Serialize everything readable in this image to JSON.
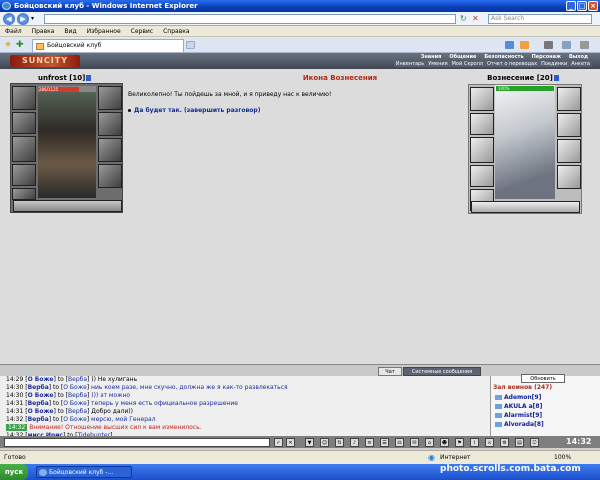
{
  "window": {
    "title": "Бойцовский клуб - Windows Internet Explorer"
  },
  "address": {
    "url": "",
    "search_placeholder": "Ask Search"
  },
  "menu": [
    "Файл",
    "Правка",
    "Вид",
    "Избранное",
    "Сервис",
    "Справка"
  ],
  "tab": {
    "label": "Бойцовский клуб"
  },
  "site": {
    "logo": "SUNCITY",
    "nav_top": [
      "Знания",
      "Общение",
      "Безопасность",
      "Персонаж",
      "Выход"
    ],
    "nav_sub": [
      "Инвентарь",
      "Умения",
      "Мой Скролл",
      "Отчет о переводах",
      "Поединки",
      "Анкета"
    ]
  },
  "left_char": {
    "name": "unfrost",
    "level": "[10]",
    "hp": "286/1125"
  },
  "dialog": {
    "title": "Икона Вознесения",
    "text": "Великолепно! Ты пойдешь за мной, и я приведу нас к величию!",
    "link": "Да будет так. (завершить разговор)"
  },
  "right_char": {
    "name": "Вознесение",
    "level": "[20]",
    "hp": "100%"
  },
  "chat_tabs": {
    "chat": "Чат",
    "system": "Системные сообщения"
  },
  "chat": [
    {
      "time": "14:29",
      "who": "О Боже",
      "to": "Верба",
      "text": ")) Не хулигань",
      "cls": "ct"
    },
    {
      "time": "14:30",
      "who": "Верба",
      "to": "О Боже",
      "text": "ниь коем разе, мне скучно, должна же я как-то развлекаться",
      "cls": "cs"
    },
    {
      "time": "14:30",
      "who": "О Боже",
      "to": "Верба",
      "text": "))) эт можно",
      "cls": "cs"
    },
    {
      "time": "14:31",
      "who": "Верба",
      "to": "О Боже",
      "text": "теперь у меня есть официальное разрешение",
      "cls": "cs"
    },
    {
      "time": "14:31",
      "who": "О Боже",
      "to": "Верба",
      "text": "Добро дали))",
      "cls": "ct"
    },
    {
      "time": "14:32",
      "who": "Верба",
      "to": "О Боже",
      "text": "мерсю, мой Генерал",
      "cls": "cs"
    },
    {
      "time": "14:32",
      "who": "",
      "to": "",
      "text": "Внимание! Отношение высших сил к вам изменилось.",
      "cls": "cr"
    },
    {
      "time": "14:32",
      "who": "мисс Ирис",
      "to": "Tidehunter",
      "text": "",
      "cls": "cs"
    }
  ],
  "room": {
    "refresh": "Обновить",
    "title": "Зал воинов (247)",
    "players": [
      "Ademon[9]",
      "AKULA a[8]",
      "Alarmist[9]",
      "Alvorada[8]"
    ]
  },
  "clock": "14:32",
  "status": {
    "left": "Готово",
    "zone": "Интернет",
    "zoom": "100%"
  },
  "taskbar": {
    "start": "пуск",
    "item": "Бойцовский клуб -..."
  },
  "watermark": "photo.scrolls.com.bata.com"
}
